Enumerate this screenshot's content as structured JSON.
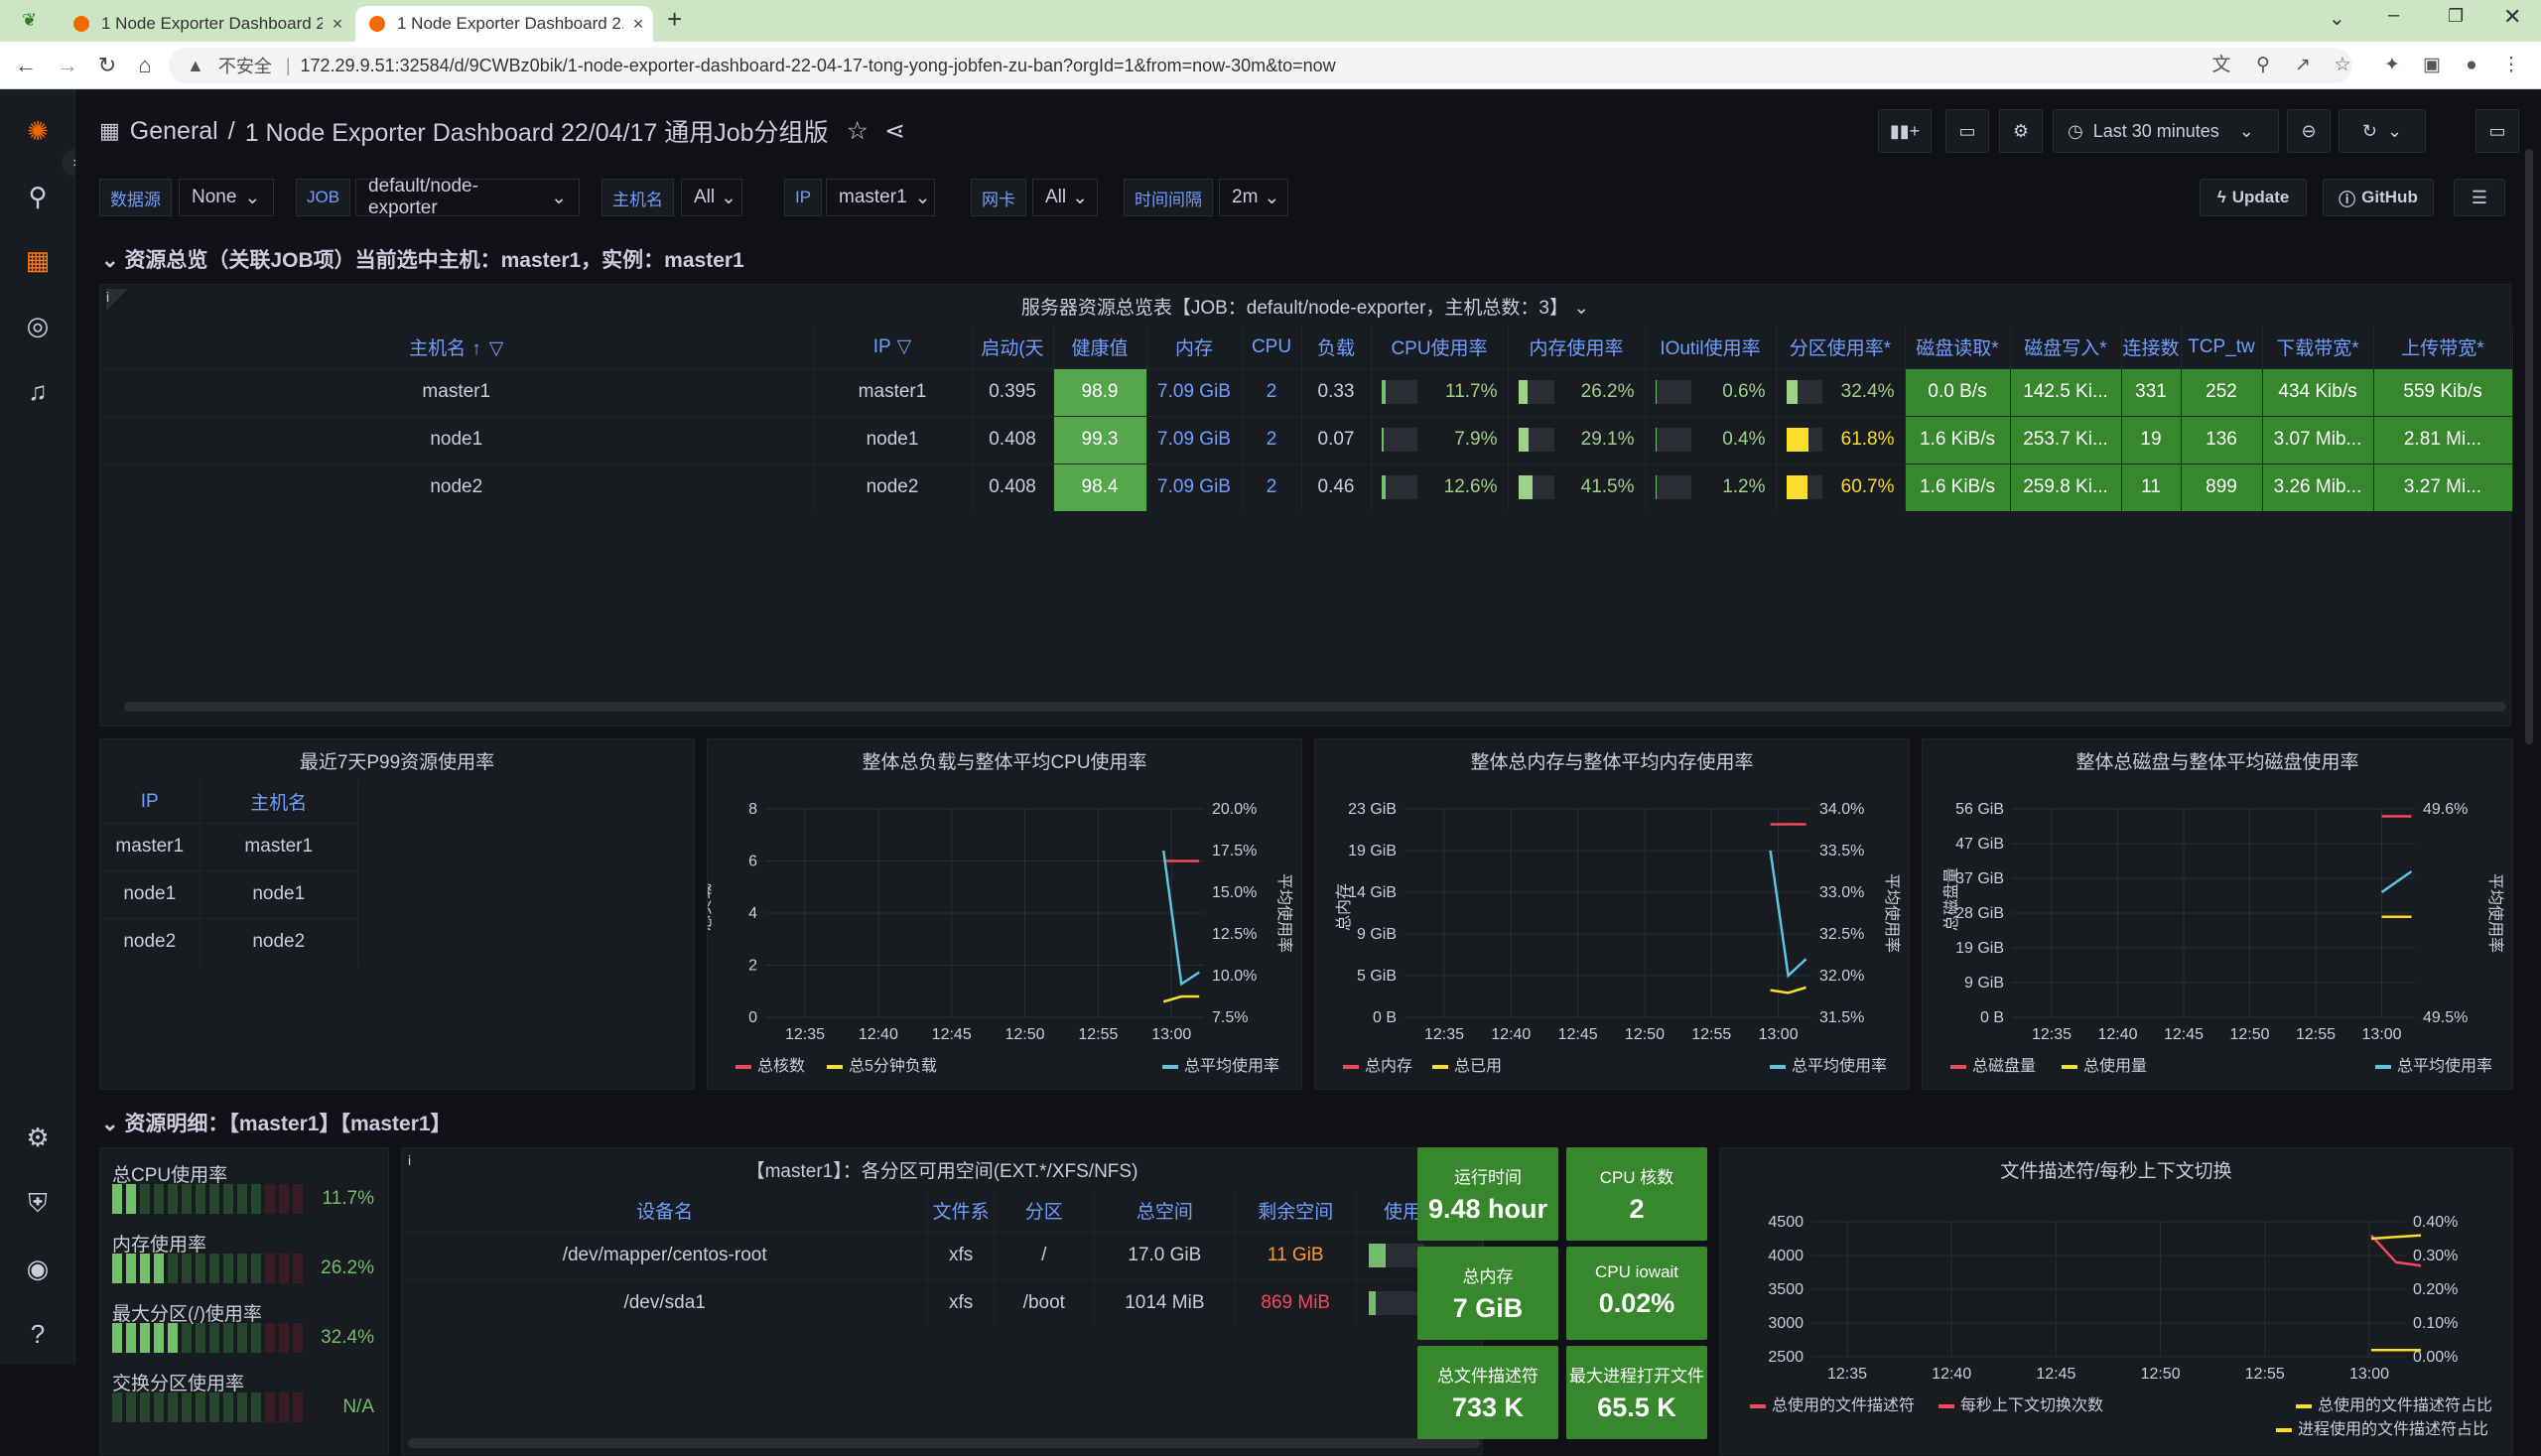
{
  "browser": {
    "tabs": [
      {
        "label": "1 Node Exporter Dashboard 2..."
      },
      {
        "label": "1 Node Exporter Dashboard 2..."
      }
    ],
    "url_warning": "不安全",
    "url": "172.29.9.51:32584/d/9CWBz0bik/1-node-exporter-dashboard-22-04-17-tong-yong-jobfen-zu-ban?orgId=1&from=now-30m&to=now"
  },
  "header": {
    "folder": "General",
    "title": "1 Node Exporter Dashboard 22/04/17 通用Job分组版",
    "time_range": "Last 30 minutes",
    "update_label": "Update",
    "github_label": "GitHub"
  },
  "variables": [
    {
      "label": "数据源",
      "value": "None"
    },
    {
      "label": "JOB",
      "value": "default/node-exporter"
    },
    {
      "label": "主机名",
      "value": "All"
    },
    {
      "label": "IP",
      "value": "master1"
    },
    {
      "label": "网卡",
      "value": "All"
    },
    {
      "label": "时间间隔",
      "value": "2m"
    }
  ],
  "row1": {
    "title": "资源总览（关联JOB项）当前选中主机：master1，实例：master1"
  },
  "overview": {
    "title": "服务器资源总览表【JOB：default/node-exporter，主机总数：3】",
    "columns": [
      "主机名",
      "IP",
      "启动(天",
      "健康值",
      "内存",
      "CPU",
      "负载",
      "CPU使用率",
      "内存使用率",
      "IOutil使用率",
      "分区使用率*",
      "磁盘读取*",
      "磁盘写入*",
      "连接数",
      "TCP_tw",
      "下载带宽*",
      "上传带宽*"
    ],
    "rows": [
      {
        "host": "master1",
        "ip": "master1",
        "uptime": "0.395",
        "health": "98.9",
        "mem": "7.09 GiB",
        "cpu": "2",
        "load": "0.33",
        "cpu_pct": "11.7%",
        "mem_pct": "26.2%",
        "io_pct": "0.6%",
        "part_pct": "32.4%",
        "disk_read": "0.0 B/s",
        "disk_write": "142.5 Ki...",
        "conn": "331",
        "tcp_tw": "252",
        "down": "434 Kib/s",
        "up": "559 Kib/s",
        "cpu_v": 0.117,
        "mem_v": 0.262,
        "io_v": 0.006,
        "part_v": 0.324
      },
      {
        "host": "node1",
        "ip": "node1",
        "uptime": "0.408",
        "health": "99.3",
        "mem": "7.09 GiB",
        "cpu": "2",
        "load": "0.07",
        "cpu_pct": "7.9%",
        "mem_pct": "29.1%",
        "io_pct": "0.4%",
        "part_pct": "61.8%",
        "disk_read": "1.6 KiB/s",
        "disk_write": "253.7 Ki...",
        "conn": "19",
        "tcp_tw": "136",
        "down": "3.07 Mib...",
        "up": "2.81 Mi...",
        "cpu_v": 0.079,
        "mem_v": 0.291,
        "io_v": 0.004,
        "part_v": 0.618
      },
      {
        "host": "node2",
        "ip": "node2",
        "uptime": "0.408",
        "health": "98.4",
        "mem": "7.09 GiB",
        "cpu": "2",
        "load": "0.46",
        "cpu_pct": "12.6%",
        "mem_pct": "41.5%",
        "io_pct": "1.2%",
        "part_pct": "60.7%",
        "disk_read": "1.6 KiB/s",
        "disk_write": "259.8 Ki...",
        "conn": "11",
        "tcp_tw": "899",
        "down": "3.26 Mib...",
        "up": "3.27 Mi...",
        "cpu_v": 0.126,
        "mem_v": 0.415,
        "io_v": 0.012,
        "part_v": 0.607
      }
    ]
  },
  "p99": {
    "title": "最近7天P99资源使用率",
    "columns": [
      "IP",
      "主机名"
    ],
    "rows": [
      [
        "master1",
        "master1"
      ],
      [
        "node1",
        "node1"
      ],
      [
        "node2",
        "node2"
      ]
    ]
  },
  "chart_data": [
    {
      "type": "line",
      "title": "整体总负载与整体平均CPU使用率",
      "x": [
        "12:35",
        "12:40",
        "12:45",
        "12:50",
        "12:55",
        "13:00"
      ],
      "ylabel": "总负载",
      "y2label": "平均使用率",
      "ylim": [
        0,
        8
      ],
      "yticks": [
        "0",
        "2",
        "4",
        "6",
        "8"
      ],
      "y2ticks": [
        "7.5%",
        "10.0%",
        "12.5%",
        "15.0%",
        "17.5%",
        "20.0%"
      ],
      "series": [
        {
          "name": "总核数",
          "color": "#f2495c",
          "values": [
            6,
            6,
            6
          ]
        },
        {
          "name": "总5分钟负载",
          "color": "#fade2a",
          "values": [
            0.6,
            0.8,
            0.8
          ]
        },
        {
          "name": "总平均使用率",
          "color": "#5ac6e0",
          "axis": "right",
          "values": [
            17.5,
            9.5,
            10.2
          ]
        }
      ]
    },
    {
      "type": "line",
      "title": "整体总内存与整体平均内存使用率",
      "x": [
        "12:35",
        "12:40",
        "12:45",
        "12:50",
        "12:55",
        "13:00"
      ],
      "ylabel": "总内存",
      "y2label": "平均使用率",
      "yticks": [
        "0 B",
        "5 GiB",
        "9 GiB",
        "14 GiB",
        "19 GiB",
        "23 GiB"
      ],
      "y2ticks": [
        "31.5%",
        "32.0%",
        "32.5%",
        "33.0%",
        "33.5%",
        "34.0%"
      ],
      "series": [
        {
          "name": "总内存",
          "color": "#f2495c",
          "values": [
            21.3,
            21.3
          ]
        },
        {
          "name": "总已用",
          "color": "#fade2a",
          "values": [
            3,
            2.7,
            3.3
          ]
        },
        {
          "name": "总平均使用率",
          "color": "#5ac6e0",
          "axis": "right",
          "values": [
            33.5,
            32.0,
            32.2
          ]
        }
      ]
    },
    {
      "type": "line",
      "title": "整体总磁盘与整体平均磁盘使用率",
      "x": [
        "12:35",
        "12:40",
        "12:45",
        "12:50",
        "12:55",
        "13:00"
      ],
      "ylabel": "总磁盘量",
      "y2label": "平均使用率",
      "yticks": [
        "0 B",
        "9 GiB",
        "19 GiB",
        "28 GiB",
        "37 GiB",
        "47 GiB",
        "56 GiB"
      ],
      "y2ticks": [
        "49.5%",
        "49.6%"
      ],
      "series": [
        {
          "name": "总磁盘量",
          "color": "#f2495c",
          "values": [
            54,
            54
          ]
        },
        {
          "name": "总使用量",
          "color": "#fade2a",
          "values": [
            27,
            27
          ]
        },
        {
          "name": "总平均使用率",
          "color": "#5ac6e0",
          "axis": "right",
          "values": [
            49.56,
            49.57
          ]
        }
      ]
    },
    {
      "type": "line",
      "title": "文件描述符/每秒上下文切换",
      "x": [
        "12:35",
        "12:40",
        "12:45",
        "12:50",
        "12:55",
        "13:00"
      ],
      "yticks": [
        "2500",
        "3000",
        "3500",
        "4000",
        "4500"
      ],
      "y2ticks": [
        "0.00%",
        "0.10%",
        "0.20%",
        "0.30%",
        "0.40%"
      ],
      "series": [
        {
          "name": "总使用的文件描述符",
          "color": "#f2495c",
          "values": [
            4300,
            3900,
            3850
          ]
        },
        {
          "name": "每秒上下文切换次数",
          "color": "#f2495c"
        },
        {
          "name": "总使用的文件描述符占比",
          "color": "#fade2a",
          "values": [
            0.35,
            0.36
          ]
        },
        {
          "name": "进程使用的文件描述符占比",
          "color": "#fade2a",
          "values": [
            0.02,
            0.02
          ]
        }
      ]
    }
  ],
  "row2": {
    "title": "资源明细：【master1】【master1】"
  },
  "gauges": [
    {
      "label": "总CPU使用率",
      "value": "11.7%",
      "level": 0.117
    },
    {
      "label": "内存使用率",
      "value": "26.2%",
      "level": 0.262
    },
    {
      "label": "最大分区(/)使用率",
      "value": "32.4%",
      "level": 0.324
    },
    {
      "label": "交换分区使用率",
      "value": "N/A",
      "level": 0
    }
  ],
  "partitions": {
    "title": "【master1】：各分区可用空间(EXT.*/XFS/NFS)",
    "columns": [
      "设备名",
      "文件系",
      "分区",
      "总空间",
      "剩余空间",
      "使用率"
    ],
    "rows": [
      {
        "dev": "/dev/mapper/centos-root",
        "fs": "xfs",
        "mount": "/",
        "total": "17.0 GiB",
        "free": "11 GiB",
        "use": "32%",
        "use_v": 0.32
      },
      {
        "dev": "/dev/sda1",
        "fs": "xfs",
        "mount": "/boot",
        "total": "1014 MiB",
        "free": "869 MiB",
        "use": "14%",
        "use_v": 0.14
      }
    ]
  },
  "stats": [
    {
      "label": "运行时间",
      "value": "9.48 hour"
    },
    {
      "label": "CPU 核数",
      "value": "2"
    },
    {
      "label": "总内存",
      "value": "7 GiB"
    },
    {
      "label": "CPU iowait",
      "value": "0.02%"
    },
    {
      "label": "总文件描述符",
      "value": "733 K"
    },
    {
      "label": "最大进程打开文件",
      "value": "65.5 K"
    }
  ]
}
